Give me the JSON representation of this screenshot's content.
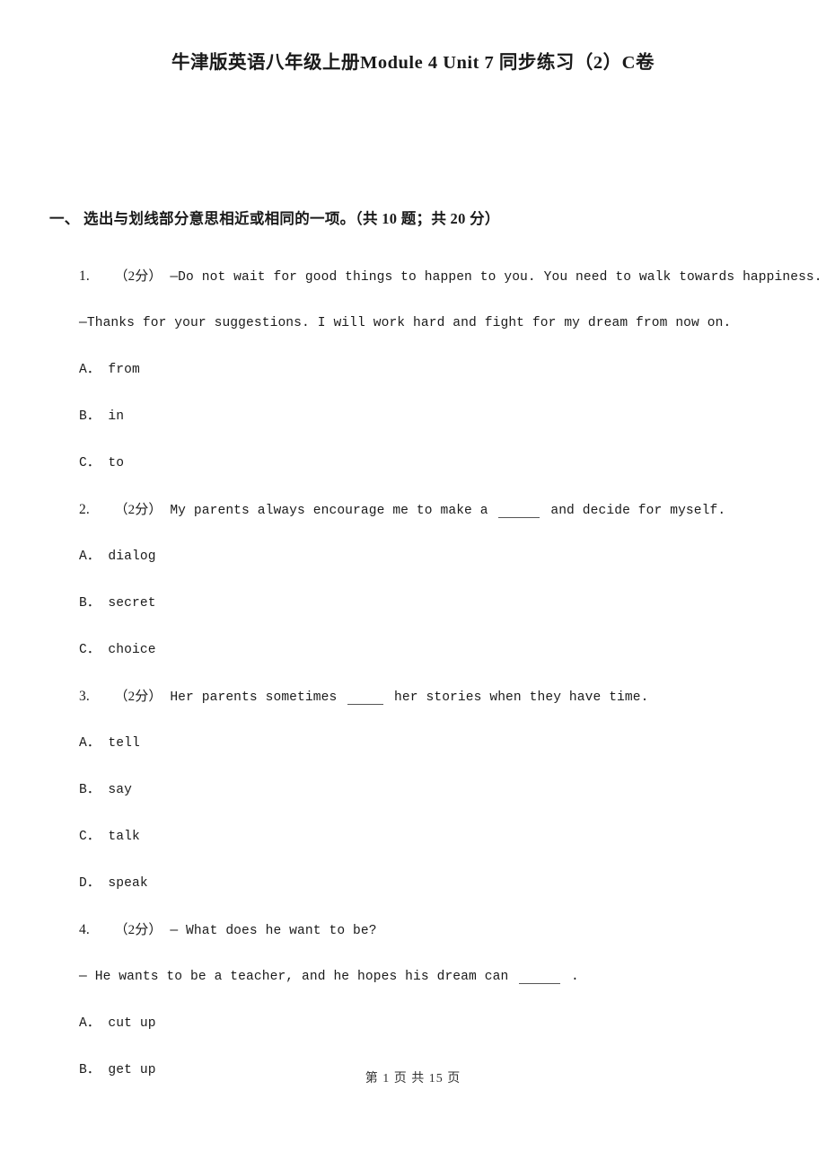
{
  "document": {
    "title": "牛津版英语八年级上册Module 4 Unit 7 同步练习（2）C卷",
    "footer": "第 1 页 共 15 页"
  },
  "section": {
    "header": "一、 选出与划线部分意思相近或相同的一项。（共 10 题；共 20 分）"
  },
  "questions": [
    {
      "number": "1.",
      "marks": "（2分）",
      "stem": "—Do not wait for good things to happen to you. You need to walk towards happiness.",
      "stem2": "—Thanks for your suggestions. I will work hard and fight for my dream from now on.",
      "options": [
        {
          "label": "A．",
          "text": "from"
        },
        {
          "label": "B．",
          "text": "in"
        },
        {
          "label": "C．",
          "text": "to"
        }
      ]
    },
    {
      "number": "2.",
      "marks": "（2分）",
      "stem_before": "My parents always encourage me to make a ",
      "stem_after": " and decide for myself.",
      "options": [
        {
          "label": "A．",
          "text": "dialog"
        },
        {
          "label": "B．",
          "text": "secret"
        },
        {
          "label": "C．",
          "text": "choice"
        }
      ]
    },
    {
      "number": "3.",
      "marks": "（2分）",
      "stem_before": "Her parents sometimes ",
      "stem_after": " her stories when they have time.",
      "options": [
        {
          "label": "A．",
          "text": "tell"
        },
        {
          "label": "B．",
          "text": "say"
        },
        {
          "label": "C．",
          "text": "talk"
        },
        {
          "label": "D．",
          "text": "speak"
        }
      ]
    },
    {
      "number": "4.",
      "marks": "（2分）",
      "stem": "— What does he want to be?",
      "stem2_before": "— He wants to be a teacher, and he hopes his dream can ",
      "stem2_after": ".",
      "options": [
        {
          "label": "A．",
          "text": "cut up"
        },
        {
          "label": "B．",
          "text": "get up"
        }
      ]
    }
  ]
}
